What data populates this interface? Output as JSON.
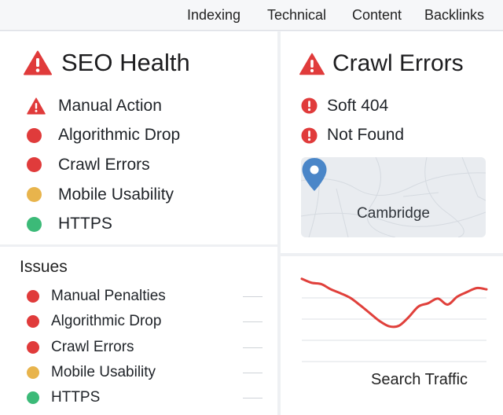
{
  "nav": {
    "items": [
      {
        "label": "Indexing"
      },
      {
        "label": "Technical"
      },
      {
        "label": "Content"
      },
      {
        "label": "Backlinks"
      }
    ]
  },
  "seo_health": {
    "title": "SEO Health",
    "items": [
      {
        "label": "Manual Action",
        "status": "warning-triangle",
        "color": "#e03b3b"
      },
      {
        "label": "Algorithmic Drop",
        "status": "critical",
        "color": "#e03b3b"
      },
      {
        "label": "Crawl Errors",
        "status": "critical",
        "color": "#e03b3b"
      },
      {
        "label": "Mobile Usability",
        "status": "warning",
        "color": "#e8b44c"
      },
      {
        "label": "HTTPS",
        "status": "ok",
        "color": "#3cba78"
      }
    ]
  },
  "issues": {
    "heading": "Issues",
    "items": [
      {
        "label": "Manual Penalties",
        "color": "#e03b3b"
      },
      {
        "label": "Algorithmic Drop",
        "color": "#e03b3b"
      },
      {
        "label": "Crawl Errors",
        "color": "#e03b3b"
      },
      {
        "label": "Mobile Usability",
        "color": "#e8b44c"
      },
      {
        "label": "HTTPS",
        "color": "#3cba78"
      }
    ]
  },
  "crawl_errors": {
    "title": "Crawl Errors",
    "items": [
      {
        "label": "Soft 404",
        "icon": "error-circle-icon",
        "color": "#e03b3b"
      },
      {
        "label": "Not Found",
        "icon": "error-circle-icon",
        "color": "#e03b3b"
      }
    ],
    "map": {
      "location": "Cambridge",
      "pin_color": "#4a86c8"
    }
  },
  "traffic": {
    "label": "Search Traffic",
    "line_color": "#e0403b"
  },
  "chart_data": {
    "type": "line",
    "title": "Search Traffic",
    "xlabel": "",
    "ylabel": "",
    "x": [
      0,
      1,
      2,
      3,
      4,
      5,
      6,
      7,
      8,
      9,
      10,
      11,
      12,
      13,
      14,
      15,
      16,
      17,
      18,
      19
    ],
    "series": [
      {
        "values": [
          92,
          86,
          84,
          76,
          70,
          63,
          52,
          40,
          28,
          20,
          21,
          34,
          50,
          55,
          62,
          53,
          65,
          72,
          78,
          76
        ]
      }
    ],
    "ylim": [
      0,
      100
    ],
    "grid": true,
    "legend": "none"
  },
  "colors": {
    "critical": "#e03b3b",
    "warning": "#e8b44c",
    "ok": "#3cba78",
    "panel_bg": "#ffffff",
    "page_bg": "#eef0f3"
  }
}
